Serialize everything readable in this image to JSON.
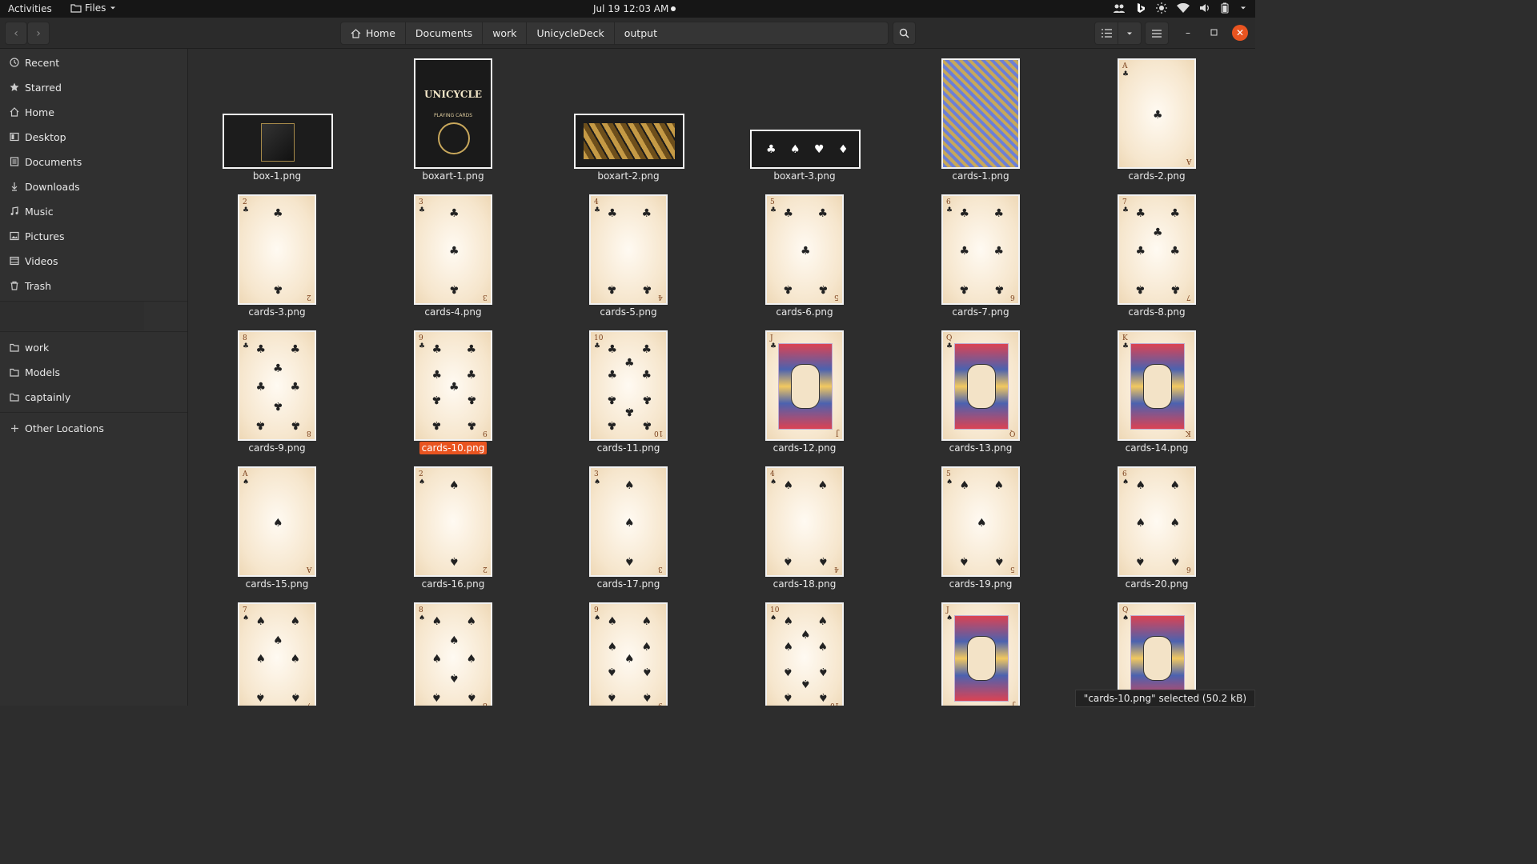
{
  "topbar": {
    "activities": "Activities",
    "app_menu": "Files",
    "clock": "Jul 19  12:03 AM"
  },
  "header": {
    "breadcrumbs": [
      "Home",
      "Documents",
      "work",
      "UnicycleDeck",
      "output"
    ]
  },
  "sidebar": {
    "places": [
      {
        "label": "Recent",
        "icon": "clock-icon"
      },
      {
        "label": "Starred",
        "icon": "star-icon"
      },
      {
        "label": "Home",
        "icon": "home-icon"
      },
      {
        "label": "Desktop",
        "icon": "desktop-icon"
      },
      {
        "label": "Documents",
        "icon": "document-icon"
      },
      {
        "label": "Downloads",
        "icon": "download-icon"
      },
      {
        "label": "Music",
        "icon": "music-icon"
      },
      {
        "label": "Pictures",
        "icon": "picture-icon"
      },
      {
        "label": "Videos",
        "icon": "video-icon"
      },
      {
        "label": "Trash",
        "icon": "trash-icon"
      }
    ],
    "bookmarks": [
      {
        "label": "work",
        "icon": "folder-icon"
      },
      {
        "label": "Models",
        "icon": "folder-icon"
      },
      {
        "label": "captainly",
        "icon": "folder-icon"
      }
    ],
    "other_locations": "Other Locations"
  },
  "files": [
    {
      "name": "box-1.png",
      "kind": "box"
    },
    {
      "name": "boxart-1.png",
      "kind": "boxart1"
    },
    {
      "name": "boxart-2.png",
      "kind": "boxart2"
    },
    {
      "name": "boxart-3.png",
      "kind": "boxart3"
    },
    {
      "name": "cards-1.png",
      "kind": "back"
    },
    {
      "name": "cards-2.png",
      "kind": "card",
      "rank": "A",
      "suit": "♣",
      "n": 1
    },
    {
      "name": "cards-3.png",
      "kind": "card",
      "rank": "2",
      "suit": "♣",
      "n": 2
    },
    {
      "name": "cards-4.png",
      "kind": "card",
      "rank": "3",
      "suit": "♣",
      "n": 3
    },
    {
      "name": "cards-5.png",
      "kind": "card",
      "rank": "4",
      "suit": "♣",
      "n": 4
    },
    {
      "name": "cards-6.png",
      "kind": "card",
      "rank": "5",
      "suit": "♣",
      "n": 5
    },
    {
      "name": "cards-7.png",
      "kind": "card",
      "rank": "6",
      "suit": "♣",
      "n": 6
    },
    {
      "name": "cards-8.png",
      "kind": "card",
      "rank": "7",
      "suit": "♣",
      "n": 7
    },
    {
      "name": "cards-9.png",
      "kind": "card",
      "rank": "8",
      "suit": "♣",
      "n": 8
    },
    {
      "name": "cards-10.png",
      "kind": "card",
      "rank": "9",
      "suit": "♣",
      "n": 9,
      "selected": true
    },
    {
      "name": "cards-11.png",
      "kind": "card",
      "rank": "10",
      "suit": "♣",
      "n": 10
    },
    {
      "name": "cards-12.png",
      "kind": "face",
      "rank": "J",
      "suit": "♣"
    },
    {
      "name": "cards-13.png",
      "kind": "face",
      "rank": "Q",
      "suit": "♣"
    },
    {
      "name": "cards-14.png",
      "kind": "face",
      "rank": "K",
      "suit": "♣"
    },
    {
      "name": "cards-15.png",
      "kind": "card",
      "rank": "A",
      "suit": "♠",
      "n": 1
    },
    {
      "name": "cards-16.png",
      "kind": "card",
      "rank": "2",
      "suit": "♠",
      "n": 2
    },
    {
      "name": "cards-17.png",
      "kind": "card",
      "rank": "3",
      "suit": "♠",
      "n": 3
    },
    {
      "name": "cards-18.png",
      "kind": "card",
      "rank": "4",
      "suit": "♠",
      "n": 4
    },
    {
      "name": "cards-19.png",
      "kind": "card",
      "rank": "5",
      "suit": "♠",
      "n": 5
    },
    {
      "name": "cards-20.png",
      "kind": "card",
      "rank": "6",
      "suit": "♠",
      "n": 6
    },
    {
      "name": "",
      "kind": "card",
      "rank": "7",
      "suit": "♠",
      "n": 7
    },
    {
      "name": "",
      "kind": "card",
      "rank": "8",
      "suit": "♠",
      "n": 8
    },
    {
      "name": "",
      "kind": "card",
      "rank": "9",
      "suit": "♠",
      "n": 9
    },
    {
      "name": "",
      "kind": "card",
      "rank": "10",
      "suit": "♠",
      "n": 10
    },
    {
      "name": "",
      "kind": "face",
      "rank": "J",
      "suit": "♠"
    },
    {
      "name": "",
      "kind": "face",
      "rank": "Q",
      "suit": "♠"
    }
  ],
  "boxart": {
    "title": "UNICYCLE",
    "subtitle": "PLAYING CARDS",
    "suits": [
      "♣",
      "♠",
      "♥",
      "♦"
    ]
  },
  "status": "\"cards-10.png\" selected  (50.2 kB)",
  "colors": {
    "accent": "#e95420"
  }
}
